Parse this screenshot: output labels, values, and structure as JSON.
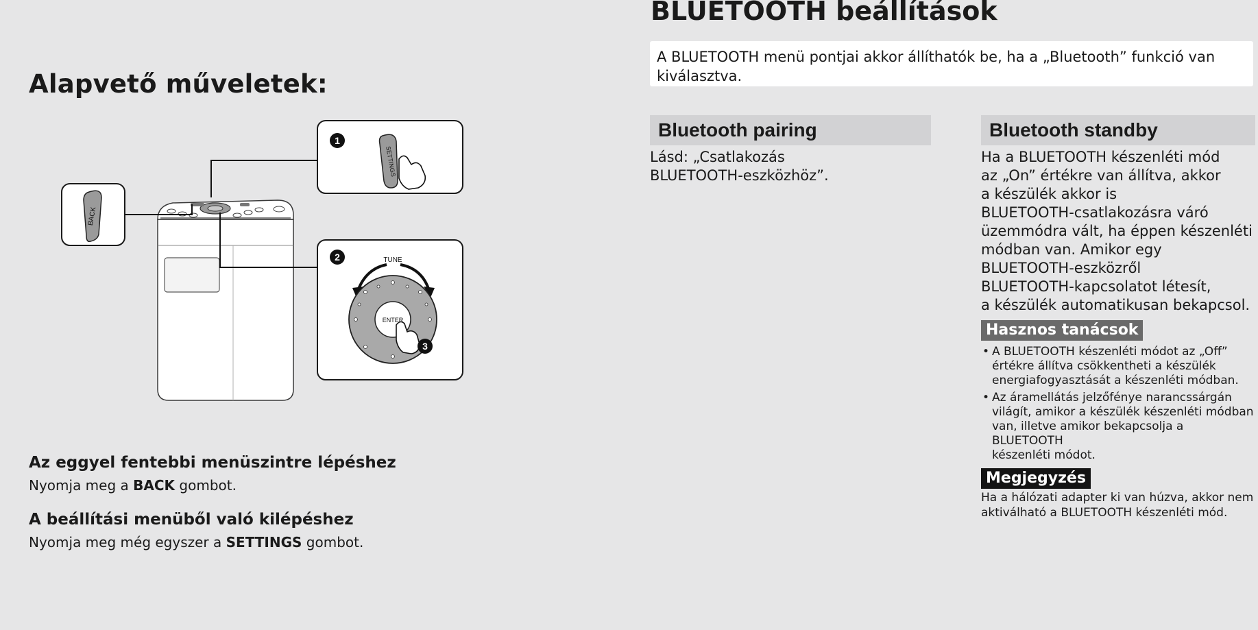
{
  "left": {
    "title": "Alapvető műveletek:",
    "diagram": {
      "back_label": "BACK",
      "settings_label": "SETTINGS",
      "tune_label": "TUNE",
      "enter_label": "ENTER",
      "step1": "1",
      "step2": "2",
      "step3": "3"
    },
    "sections": [
      {
        "heading": "Az eggyel fentebbi menüszintre lépéshez",
        "pre": "Nyomja meg a ",
        "bold": "BACK",
        "post": " gombot."
      },
      {
        "heading": "A beállítási menüből való kilépéshez",
        "pre": "Nyomja meg még egyszer a ",
        "bold": "SETTINGS",
        "post": " gombot."
      }
    ]
  },
  "right": {
    "title": "BLUETOOTH beállítások",
    "intro": "A BLUETOOTH menü pontjai akkor állíthatók be, ha a „Bluetooth” funkció van kiválasztva.",
    "pairing": {
      "heading": "Bluetooth pairing",
      "lines": [
        "Lásd: „Csatlakozás",
        "BLUETOOTH-eszközhöz”."
      ]
    },
    "standby": {
      "heading": "Bluetooth standby",
      "lines": [
        "Ha a BLUETOOTH készenléti mód",
        "az „On” értékre van állítva, akkor",
        "a készülék akkor is",
        "BLUETOOTH-csatlakozásra váró",
        "üzemmódra vált, ha éppen készenléti",
        "módban van. Amikor egy",
        "BLUETOOTH-eszközről",
        "BLUETOOTH-kapcsolatot létesít,",
        "a készülék automatikusan bekapcsol."
      ],
      "tips_label": "Hasznos tanácsok",
      "tips": [
        [
          "A BLUETOOTH készenléti módot az „Off”",
          "értékre állítva csökkentheti a készülék",
          "energiafogyasztását a készenléti módban."
        ],
        [
          "Az áramellátás jelzőfénye narancssárgán",
          "világít, amikor a készülék készenléti módban",
          "van, illetve amikor bekapcsolja a BLUETOOTH",
          "készenléti módot."
        ]
      ],
      "note_label": "Megjegyzés",
      "note": [
        "Ha a hálózati adapter ki van húzva, akkor nem",
        "aktiválható a BLUETOOTH készenléti mód."
      ]
    }
  }
}
